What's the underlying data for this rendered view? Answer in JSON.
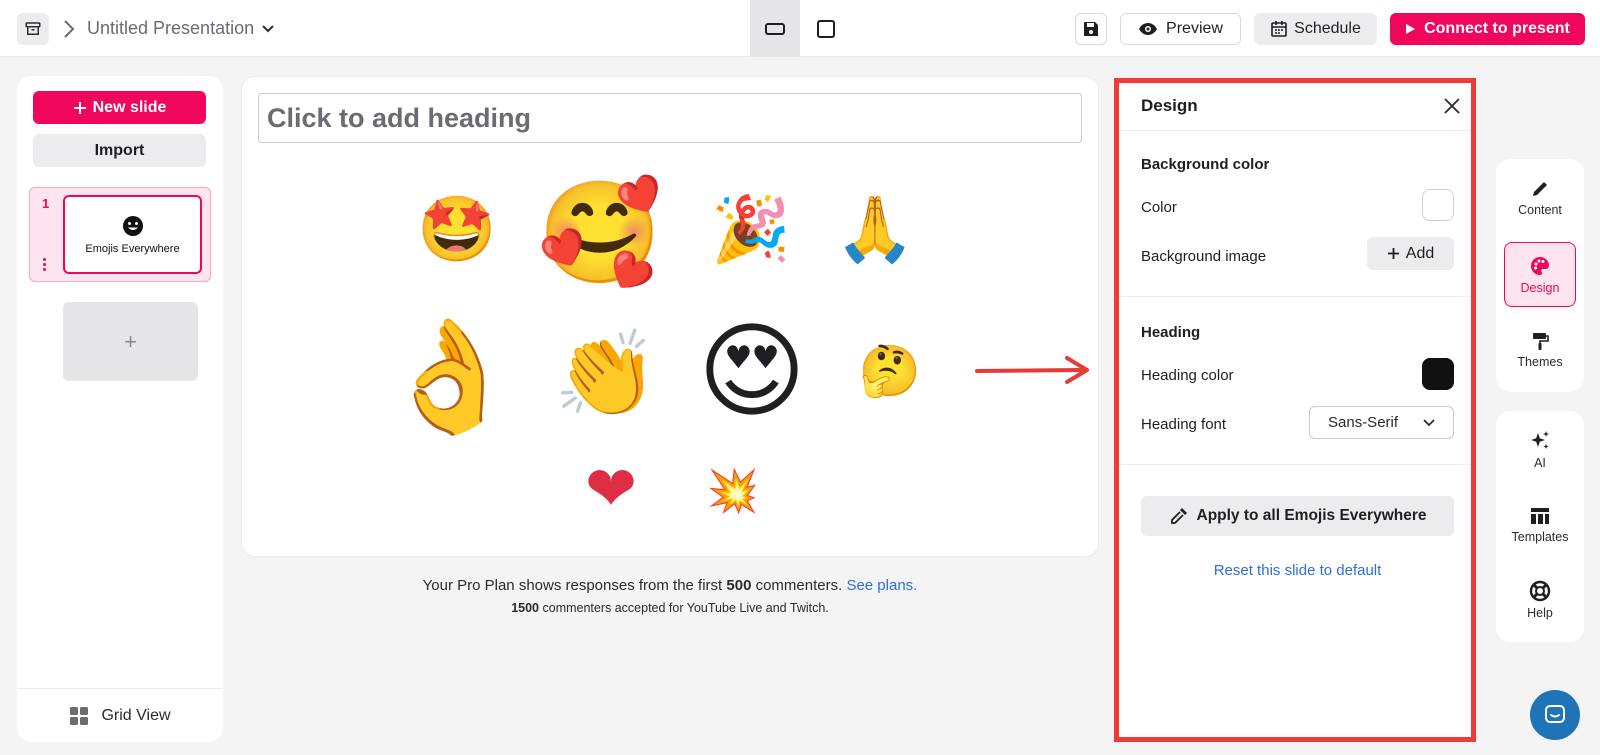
{
  "header": {
    "title": "Untitled Presentation",
    "preview_label": "Preview",
    "schedule_label": "Schedule",
    "connect_label": "Connect to present"
  },
  "sidebar": {
    "new_slide_label": "New slide",
    "import_label": "Import",
    "slides": [
      {
        "number": "1",
        "title": "Emojis Everywhere"
      }
    ],
    "add_slide_symbol": "+",
    "grid_view_label": "Grid View"
  },
  "canvas": {
    "heading_placeholder": "Click to add heading",
    "emojis": [
      {
        "name": "star-struck-emoji",
        "char": "🤩"
      },
      {
        "name": "smiling-face-with-hearts-emoji",
        "char": "🥰"
      },
      {
        "name": "party-popper-emoji",
        "char": "🎉"
      },
      {
        "name": "folded-hands-emoji",
        "char": "🙏"
      },
      {
        "name": "ok-hand-emoji",
        "char": "👌"
      },
      {
        "name": "clapping-hands-emoji",
        "char": "👏"
      },
      {
        "name": "heart-eyes-emoji",
        "char": "😍"
      },
      {
        "name": "thinking-face-emoji",
        "char": "🤔"
      },
      {
        "name": "red-heart-emoji",
        "char": "❤"
      },
      {
        "name": "collision-emoji",
        "char": "💥"
      }
    ]
  },
  "plan_note": {
    "text_before": "Your Pro Plan shows responses from the first ",
    "count": "500",
    "text_after": " commenters. ",
    "link": "See plans.",
    "sub_count": "1500",
    "sub_text": " commenters accepted for YouTube Live and Twitch."
  },
  "design_panel": {
    "title": "Design",
    "background_section": "Background color",
    "color_label": "Color",
    "background_image_label": "Background image",
    "add_label": "Add",
    "heading_section": "Heading",
    "heading_color_label": "Heading color",
    "heading_font_label": "Heading font",
    "heading_font_value": "Sans-Serif",
    "apply_label": "Apply to all Emojis Everywhere",
    "reset_label": "Reset this slide to default",
    "background_color": "#ffffff",
    "heading_color": "#111111"
  },
  "rail": {
    "content_label": "Content",
    "design_label": "Design",
    "themes_label": "Themes",
    "ai_label": "AI",
    "templates_label": "Templates",
    "help_label": "Help"
  },
  "colors": {
    "accent": "#f0075b",
    "highlight_border": "#ef3b36",
    "link": "#2f6fd6"
  }
}
